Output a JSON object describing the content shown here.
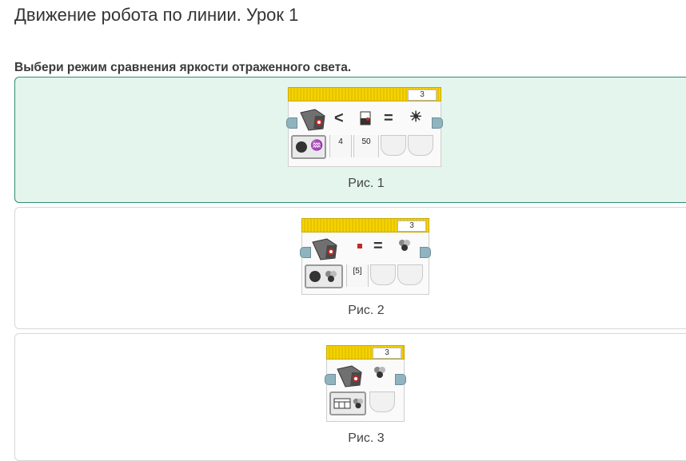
{
  "page": {
    "title": "Движение робота по линии. Урок 1",
    "question": "Выбери режим сравнения яркости отраженного света."
  },
  "options": [
    {
      "caption": "Рис. 1",
      "block_number": "3",
      "params": [
        "4",
        "50"
      ],
      "selected": true
    },
    {
      "caption": "Рис. 2",
      "block_number": "3",
      "params": [
        "[5]"
      ],
      "selected": false
    },
    {
      "caption": "Рис. 3",
      "block_number": "3",
      "params": [],
      "selected": false
    }
  ],
  "colors": {
    "accent": "#2e8f73",
    "selected_bg": "#e3f5ec",
    "block_yellow": "#f4d400"
  }
}
